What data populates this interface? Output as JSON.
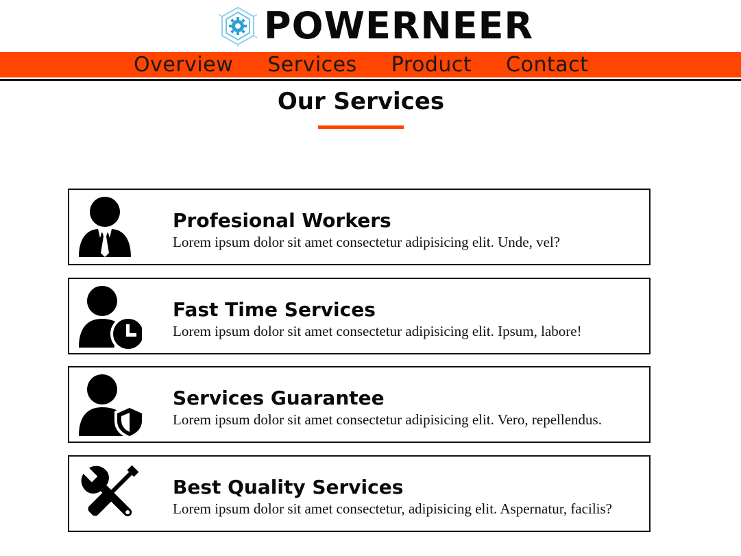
{
  "brand": {
    "name": "POWERNEER",
    "logo_icon": "hexagon-gear-logo-icon"
  },
  "nav": {
    "items": [
      {
        "label": "Overview"
      },
      {
        "label": "Services"
      },
      {
        "label": "Product"
      },
      {
        "label": "Contact"
      }
    ]
  },
  "section": {
    "title": "Our Services"
  },
  "services": [
    {
      "title": "Profesional Workers",
      "text": "Lorem ipsum dolor sit amet consectetur adipisicing elit. Unde, vel?",
      "icon": "businessman-icon"
    },
    {
      "title": "Fast Time Services",
      "text": "Lorem ipsum dolor sit amet consectetur adipisicing elit. Ipsum, labore!",
      "icon": "user-clock-icon"
    },
    {
      "title": "Services Guarantee",
      "text": "Lorem ipsum dolor sit amet consectetur adipisicing elit. Vero, repellendus.",
      "icon": "user-shield-icon"
    },
    {
      "title": "Best Quality Services",
      "text": "Lorem ipsum dolor sit amet consectetur, adipisicing elit. Aspernatur, facilis?",
      "icon": "tools-icon"
    }
  ],
  "colors": {
    "accent": "#ff4500",
    "text": "#0a0a0a",
    "logo": "#4fb6e0"
  }
}
